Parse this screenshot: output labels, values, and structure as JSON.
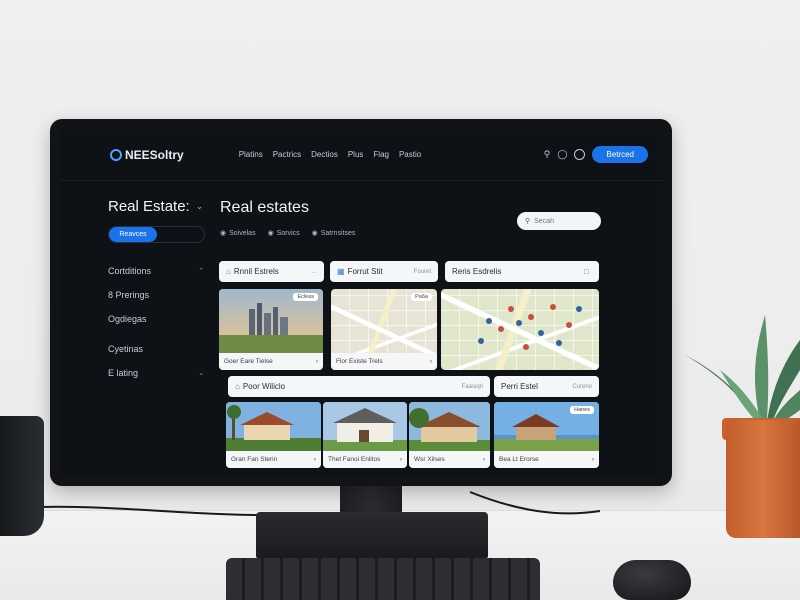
{
  "app": {
    "brand": "NEESoltry",
    "nav": [
      "Platins",
      "Pactrics",
      "Dectios",
      "Plus",
      "Flag",
      "Pastio"
    ],
    "cta_label": "Betrced"
  },
  "sidebar": {
    "title": "Real Estate:",
    "toggle_active": "Reavces",
    "items": [
      {
        "label": "Cortditions",
        "chevron": "up"
      },
      {
        "label": "8 Prerings",
        "chevron": ""
      },
      {
        "label": "Ogdiegas",
        "chevron": ""
      },
      {
        "label": "Cyetinas",
        "chevron": ""
      },
      {
        "label": "E lating",
        "chevron": "down"
      }
    ]
  },
  "main": {
    "title": "Real estates",
    "filters": [
      "Soivelas",
      "Sorvics",
      "Satrnsitses"
    ],
    "search_placeholder": "Secah"
  },
  "cards_row1": [
    {
      "label": "Rnnil Estrels",
      "meta": "…"
    },
    {
      "label": "Forrut Stit",
      "meta": "Fouret"
    },
    {
      "label": "Reris Esdrelis",
      "meta": ""
    }
  ],
  "tiles_row1": [
    {
      "caption": "Goer Eare Tielse",
      "tag": "Ecleas"
    },
    {
      "caption": "Flor Existe Trels",
      "tag": "Pa6a"
    },
    {
      "caption": "",
      "tag": ""
    }
  ],
  "cards_row2": [
    {
      "label": "Poor Wiliclo",
      "meta": "Faasiqn"
    },
    {
      "label": "Perri Estel",
      "meta": "Cureno"
    }
  ],
  "tiles_row2": [
    {
      "caption": "Gran Fan Sterin",
      "tag": ""
    },
    {
      "caption": "Thet Fanoi Enlitos",
      "tag": ""
    },
    {
      "caption": "Wsr Xilses",
      "tag": ""
    },
    {
      "caption": "Bea Lt Erorse",
      "tag": "Hanes"
    }
  ],
  "colors": {
    "accent": "#1a73e8",
    "screen_bg": "#0e1116",
    "card_bg": "#f4f6f8"
  },
  "icons": [
    "globe-icon",
    "search-icon",
    "bell-icon",
    "settings-icon",
    "chevron-down-icon"
  ]
}
